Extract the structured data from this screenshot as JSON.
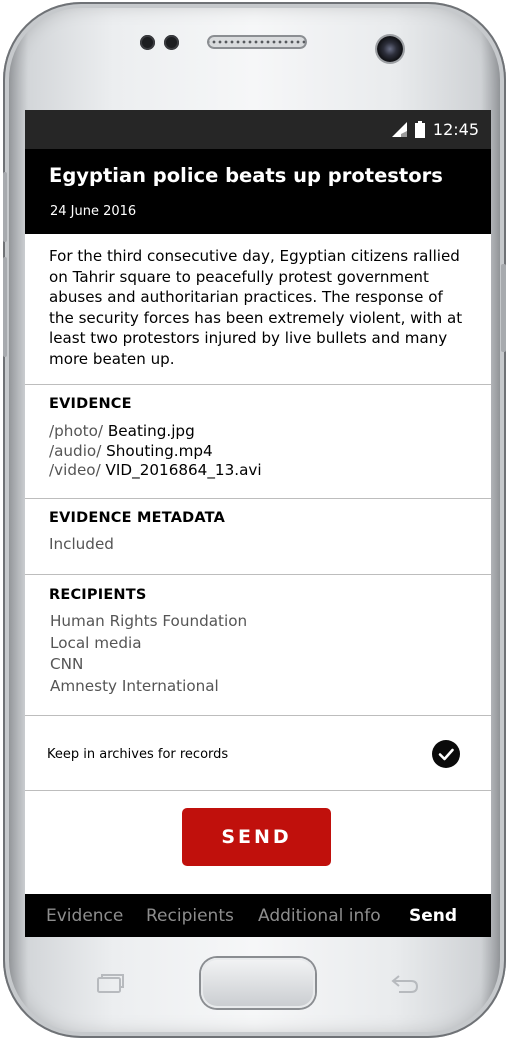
{
  "status_bar": {
    "time": "12:45",
    "icons": [
      "signal-icon",
      "battery-icon"
    ]
  },
  "report": {
    "title": "Egyptian police beats up protestors",
    "date": "24 June 2016",
    "description": "For the third consecutive day, Egyptian citizens rallied on Tahrir square to peacefully protest government abuses and authoritarian practices. The response of the security forces has been extremely violent, with at least two protestors injured by live bullets and many more beaten up."
  },
  "evidence": {
    "heading": "EVIDENCE",
    "items": [
      {
        "path": "/photo/",
        "file": "Beating.jpg"
      },
      {
        "path": "/audio/",
        "file": "Shouting.mp4"
      },
      {
        "path": "/video/",
        "file": "VID_2016864_13.avi"
      }
    ]
  },
  "metadata": {
    "heading": "EVIDENCE METADATA",
    "value": "Included"
  },
  "recipients": {
    "heading": "RECIPIENTS",
    "items": [
      "Human Rights Foundation",
      "Local media",
      "CNN",
      "Amnesty International"
    ]
  },
  "archive": {
    "label": "Keep in archives for records",
    "checked": true
  },
  "actions": {
    "send_label": "SEND",
    "send_color": "#c0100c"
  },
  "bottom_nav": {
    "items": [
      "Evidence",
      "Recipients",
      "Additional info",
      "Send"
    ],
    "active": "Send"
  },
  "colors": {
    "header_bg": "#000000",
    "status_bar_bg": "#262626",
    "accent": "#c0100c"
  }
}
